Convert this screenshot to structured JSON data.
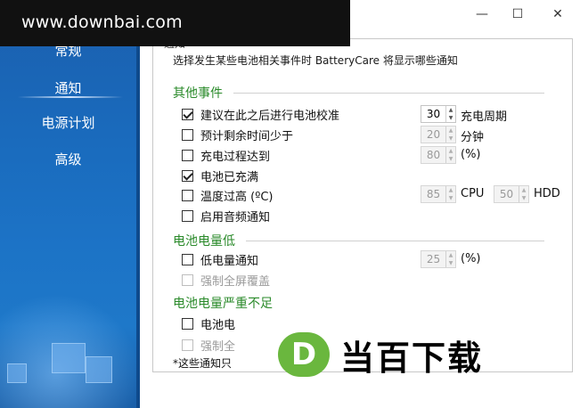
{
  "watermark": "www.downbai.com",
  "window_controls": {
    "minimize": "—",
    "maximize": "☐",
    "close": "✕"
  },
  "sidebar": {
    "items": [
      {
        "label": "常规"
      },
      {
        "label": "通知"
      },
      {
        "label": "电源计划"
      },
      {
        "label": "高级"
      }
    ]
  },
  "panel": {
    "title_fragment": "通知",
    "description": "选择发生某些电池相关事件时 BatteryCare 将显示哪些通知"
  },
  "sections": {
    "other_events": "其他事件",
    "battery_low": "电池电量低",
    "battery_critical": "电池电量严重不足"
  },
  "options": {
    "calibrate": {
      "label": "建议在此之后进行电池校准",
      "checked": true,
      "value": "30",
      "unit": "充电周期"
    },
    "remaining_time": {
      "label": "预计剩余时间少于",
      "checked": false,
      "value": "20",
      "unit": "分钟"
    },
    "charge_reached": {
      "label": "充电过程达到",
      "checked": false,
      "value": "80",
      "unit": "(%)"
    },
    "fully_charged": {
      "label": "电池已充满",
      "checked": true
    },
    "high_temp": {
      "label": "温度过高 (ºC)",
      "checked": false,
      "cpu_value": "85",
      "cpu_label": "CPU",
      "hdd_value": "50",
      "hdd_label": "HDD"
    },
    "audio": {
      "label": "启用音频通知",
      "checked": false
    },
    "low_notify": {
      "label": "低电量通知",
      "checked": false,
      "value": "25",
      "unit": "(%)"
    },
    "low_fullscreen": {
      "label": "强制全屏覆盖",
      "checked": false,
      "disabled": true
    },
    "critical_notify": {
      "label": "电池电",
      "checked": false
    },
    "critical_fullscreen": {
      "label": "强制全",
      "checked": false,
      "disabled": true
    }
  },
  "footnote": "*这些通知只",
  "logo": {
    "mark": "D",
    "text": "当百下载",
    "color": "#6ab73e"
  }
}
